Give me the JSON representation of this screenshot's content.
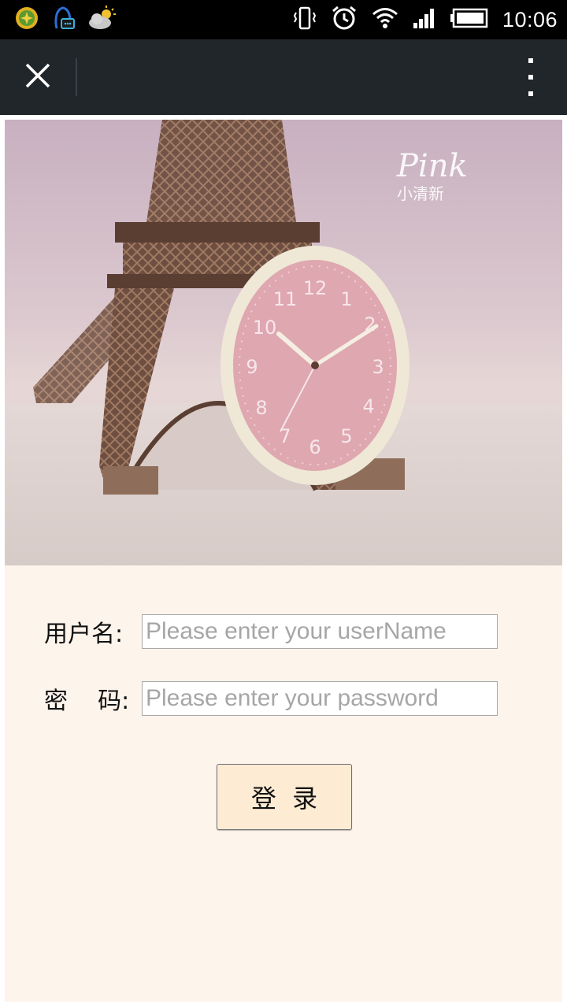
{
  "status_bar": {
    "time": "10:06",
    "left_icons": [
      "clover-app-icon",
      "qq-icon",
      "weather-cloud-icon"
    ],
    "right_icons": [
      "vibrate-icon",
      "alarm-icon",
      "wifi-icon",
      "signal-icon",
      "battery-icon"
    ]
  },
  "toolbar": {
    "close_icon": "close-icon",
    "menu_icon": "more-vert-icon"
  },
  "hero": {
    "tag_title": "Pink",
    "tag_subtitle": "小清新"
  },
  "form": {
    "username_label": "用户名:",
    "username_placeholder": "Please enter your userName",
    "password_label": "密    码:",
    "password_placeholder": "Please enter your password",
    "login_label": "登  录"
  },
  "colors": {
    "status_bar_bg": "#000000",
    "toolbar_bg": "#21262b",
    "page_bg": "#fdf4ec",
    "button_bg": "#fdebd3"
  }
}
